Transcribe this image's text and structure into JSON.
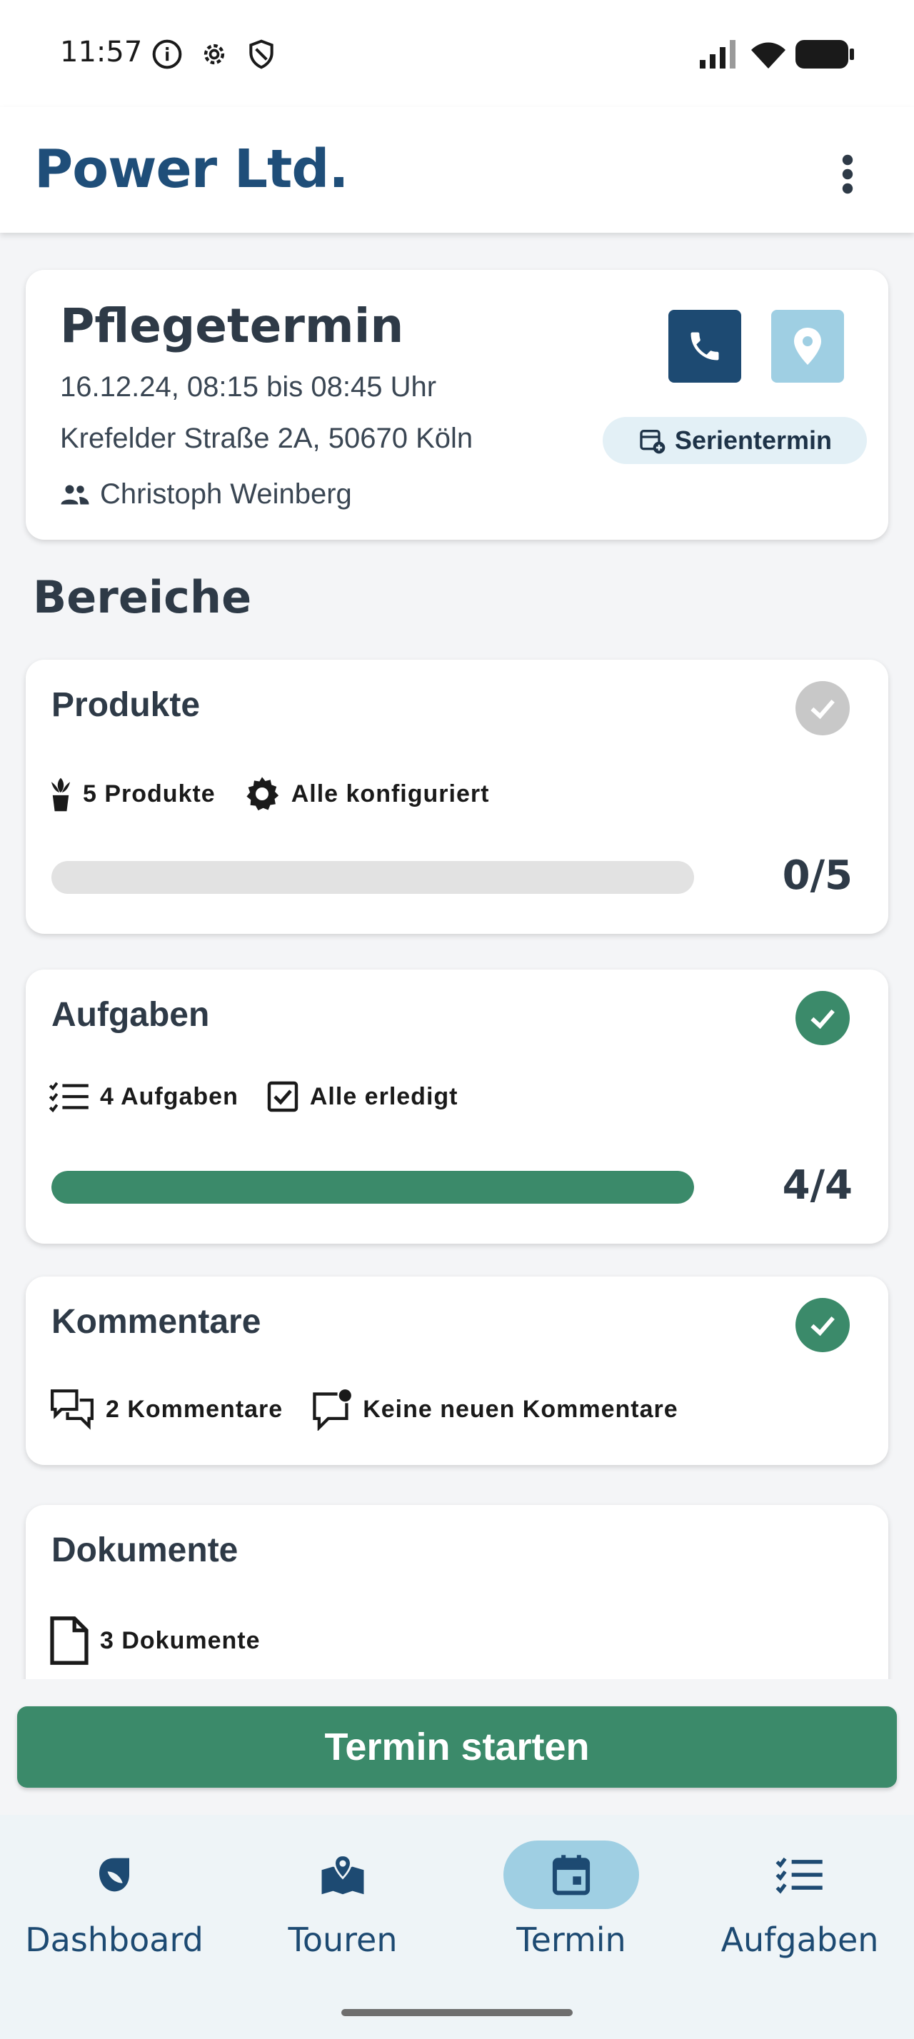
{
  "status_bar": {
    "time": "11:57",
    "icons_left": [
      "info-icon",
      "gear-icon",
      "shield-icon"
    ],
    "icons_right": [
      "signal-icon",
      "wifi-icon",
      "battery-icon"
    ]
  },
  "app_bar": {
    "brand": "Power Ltd.",
    "menu_icon": "more-vert-icon"
  },
  "appointment": {
    "title": "Pflegetermin",
    "datetime": "16.12.24, 08:15 bis 08:45 Uhr",
    "address": "Krefelder Straße 2A, 50670 Köln",
    "person": "Christoph Weinberg",
    "series_chip": "Serientermin",
    "phone_icon": "phone-icon",
    "location_icon": "location-pin-icon"
  },
  "section_title": "Bereiche",
  "areas": {
    "products": {
      "title": "Produkte",
      "count_label": "5 Produkte",
      "status_label": "Alle konfiguriert",
      "progress_done": 0,
      "progress_total": 5,
      "progress_text": "0/5",
      "completed": false
    },
    "tasks": {
      "title": "Aufgaben",
      "count_label": "4 Aufgaben",
      "status_label": "Alle erledigt",
      "progress_done": 4,
      "progress_total": 4,
      "progress_text": "4/4",
      "completed": true
    },
    "comments": {
      "title": "Kommentare",
      "count_label": "2 Kommentare",
      "status_label": "Keine neuen Kommentare",
      "completed": true
    },
    "documents": {
      "title": "Dokumente",
      "count_label": "3 Dokumente"
    }
  },
  "start_button": "Termin starten",
  "bottom_nav": {
    "items": [
      {
        "label": "Dashboard",
        "icon": "leaf-shield-icon",
        "active": false
      },
      {
        "label": "Touren",
        "icon": "map-pin-icon",
        "active": false
      },
      {
        "label": "Termin",
        "icon": "calendar-icon",
        "active": true
      },
      {
        "label": "Aufgaben",
        "icon": "checklist-icon",
        "active": false
      }
    ]
  },
  "colors": {
    "brand": "#1f4e79",
    "accent_green": "#3b8a6a",
    "accent_light_blue": "#9fcfe3",
    "background": "#f4f5f7"
  }
}
